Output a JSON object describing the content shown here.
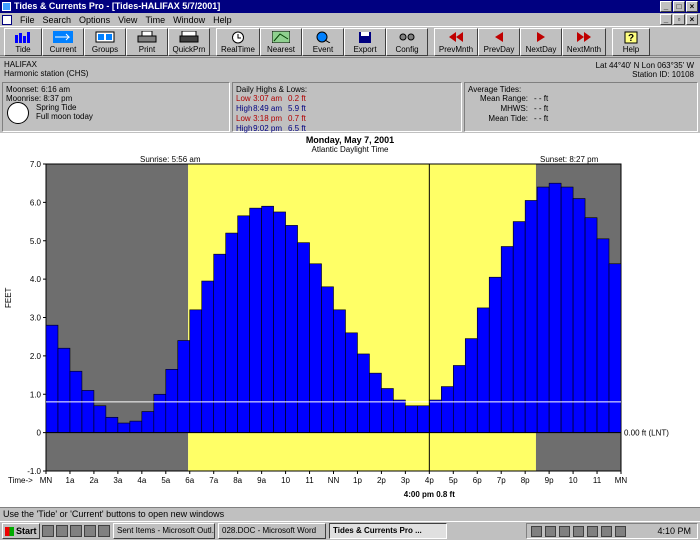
{
  "window": {
    "title": "Tides & Currents Pro - [Tides-HALIFAX  5/7/2001]"
  },
  "menu": [
    "File",
    "Search",
    "Options",
    "View",
    "Time",
    "Window",
    "Help"
  ],
  "toolbar": [
    {
      "label": "Tide",
      "icon": "tide-icon"
    },
    {
      "label": "Current",
      "icon": "current-icon"
    },
    {
      "label": "Groups",
      "icon": "groups-icon"
    },
    {
      "label": "Print",
      "icon": "printer-icon"
    },
    {
      "label": "QuickPrn",
      "icon": "quickprint-icon"
    },
    {
      "label": "RealTime",
      "icon": "clock-icon"
    },
    {
      "label": "Nearest",
      "icon": "map-icon"
    },
    {
      "label": "Event",
      "icon": "event-icon"
    },
    {
      "label": "Export",
      "icon": "disk-icon"
    },
    {
      "label": "Config",
      "icon": "config-icon"
    },
    {
      "label": "PrevMnth",
      "icon": "double-left-arrow-icon"
    },
    {
      "label": "PrevDay",
      "icon": "left-arrow-icon"
    },
    {
      "label": "NextDay",
      "icon": "right-arrow-icon"
    },
    {
      "label": "NextMnth",
      "icon": "double-right-arrow-icon"
    },
    {
      "label": "Help",
      "icon": "question-icon"
    }
  ],
  "station": {
    "name": "HALIFAX",
    "type": "Harmonic station (CHS)",
    "latlon": "Lat 44°40' N  Lon 063°35' W",
    "id": "Station ID: 10108"
  },
  "moon": {
    "moonset": "Moonset:  6:16 am",
    "moonrise": "Moonrise:  8:37 pm",
    "tide_type": "Spring Tide",
    "phase": "Full moon today"
  },
  "highs_lows": {
    "heading": "Daily Highs & Lows:",
    "rows": [
      {
        "type": "Low",
        "time": "3:07 am",
        "value": "0.2 ft"
      },
      {
        "type": "High",
        "time": "8:49 am",
        "value": "5.9 ft"
      },
      {
        "type": "Low",
        "time": "3:18 pm",
        "value": "0.7 ft"
      },
      {
        "type": "High",
        "time": "9:02 pm",
        "value": "6.5 ft"
      }
    ]
  },
  "averages": {
    "heading": "Average Tides:",
    "mean_range_label": "Mean Range:",
    "mean_range_value": "- - ft",
    "mhws_label": "MHWS:",
    "mhws_value": "- - ft",
    "mean_tide_label": "Mean Tide:",
    "mean_tide_value": "- - ft"
  },
  "chart_data": {
    "type": "bar",
    "title": "Monday, May 7, 2001",
    "subtitle": "Atlantic Daylight Time",
    "sunrise": "Sunrise: 5:56 am",
    "sunset": "Sunset: 8:27 pm",
    "ylabel": "FEET",
    "xlabel": "Time->",
    "ylim": [
      -1.0,
      7.0
    ],
    "yticks": [
      "-1.0",
      "0",
      "1.0",
      "2.0",
      "3.0",
      "4.0",
      "5.0",
      "6.0",
      "7.0"
    ],
    "xticks": [
      "MN",
      "1a",
      "2a",
      "3a",
      "4a",
      "5a",
      "6a",
      "7a",
      "8a",
      "9a",
      "10",
      "11",
      "NN",
      "1p",
      "2p",
      "3p",
      "4p",
      "5p",
      "6p",
      "7p",
      "8p",
      "9p",
      "10",
      "11",
      "MN"
    ],
    "x_hours": [
      0,
      0.5,
      1,
      1.5,
      2,
      2.5,
      3,
      3.5,
      4,
      4.5,
      5,
      5.5,
      6,
      6.5,
      7,
      7.5,
      8,
      8.5,
      9,
      9.5,
      10,
      10.5,
      11,
      11.5,
      12,
      12.5,
      13,
      13.5,
      14,
      14.5,
      15,
      15.5,
      16,
      16.5,
      17,
      17.5,
      18,
      18.5,
      19,
      19.5,
      20,
      20.5,
      21,
      21.5,
      22,
      22.5,
      23,
      23.5
    ],
    "values": [
      2.8,
      2.2,
      1.6,
      1.1,
      0.7,
      0.4,
      0.25,
      0.3,
      0.55,
      1.0,
      1.65,
      2.4,
      3.2,
      3.95,
      4.65,
      5.2,
      5.65,
      5.85,
      5.9,
      5.75,
      5.4,
      4.95,
      4.4,
      3.8,
      3.2,
      2.6,
      2.05,
      1.55,
      1.15,
      0.85,
      0.7,
      0.7,
      0.85,
      1.2,
      1.75,
      2.45,
      3.25,
      4.05,
      4.85,
      5.5,
      6.05,
      6.4,
      6.5,
      6.4,
      6.1,
      5.6,
      5.05,
      4.4
    ],
    "sunrise_hour": 5.933,
    "sunset_hour": 20.45,
    "current_hour": 16.0,
    "current_value": 0.8,
    "current_label": "4:00 pm  0.8 ft",
    "datum_label": "0.00 ft (LNT)",
    "colors": {
      "bar": "#0000ff",
      "day": "#ffff66",
      "night": "#6e6e6e",
      "bar_edge": "#000000"
    }
  },
  "status": "Use the 'Tide' or 'Current' buttons to open new windows",
  "taskbar": {
    "start": "Start",
    "tasks": [
      "Sent Items - Microsoft Outl...",
      "028.DOC - Microsoft Word",
      "Tides & Currents Pro ..."
    ],
    "clock": "4:10 PM"
  }
}
